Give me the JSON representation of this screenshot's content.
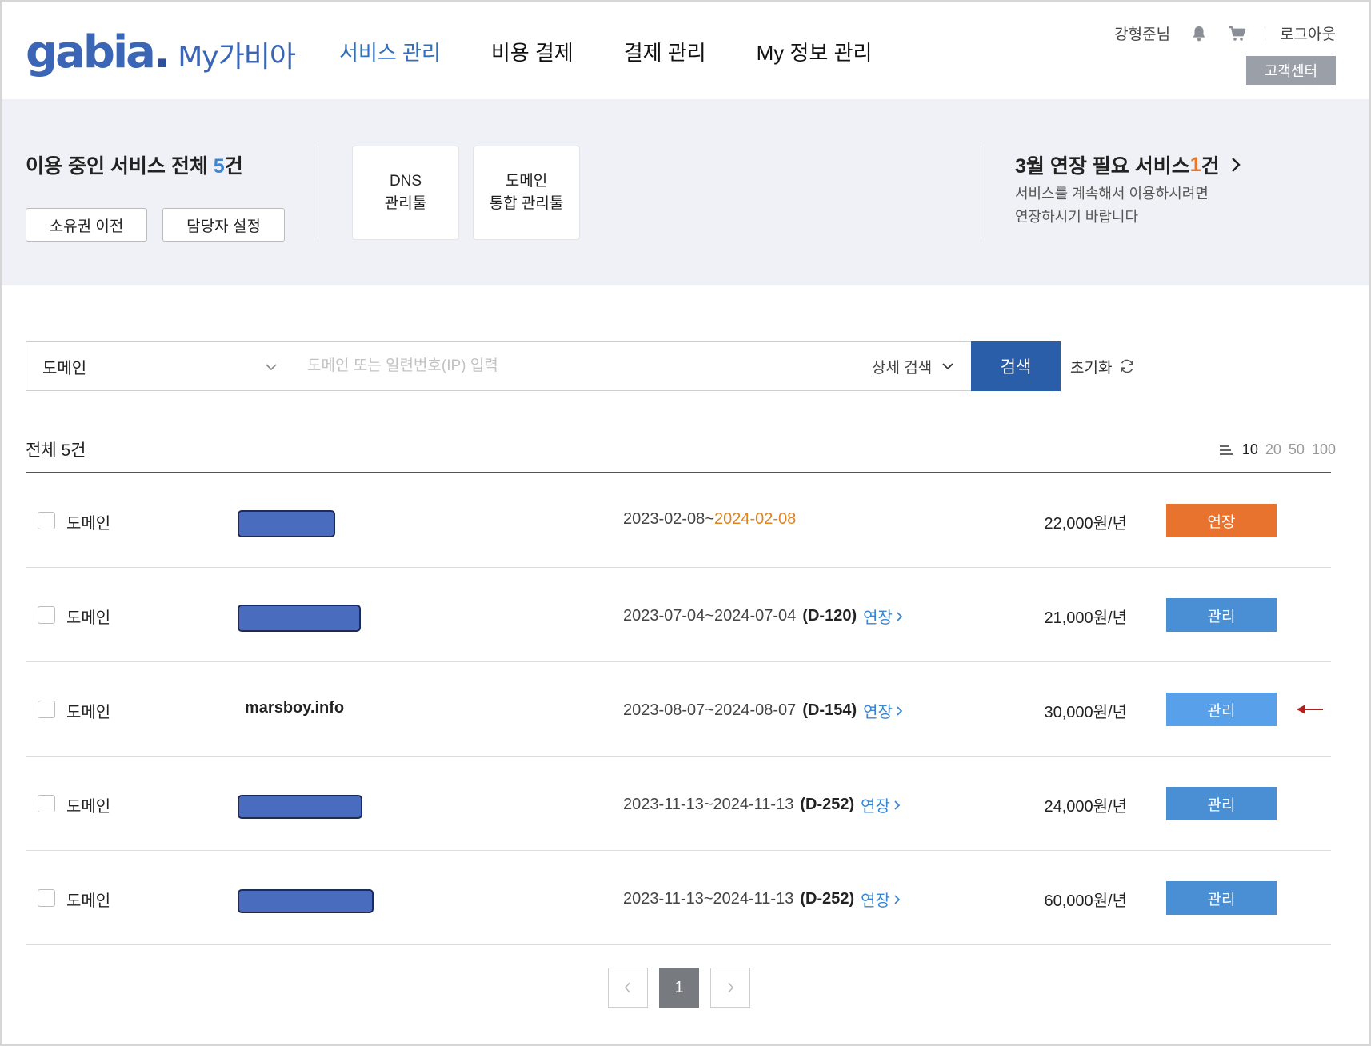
{
  "header": {
    "logo_text": "gabia",
    "logo_dot": ".",
    "logo_sub": "My가비아",
    "nav": [
      {
        "label": "서비스 관리",
        "active": true
      },
      {
        "label": "비용 결제",
        "active": false
      },
      {
        "label": "결제 관리",
        "active": false
      },
      {
        "label": "My 정보 관리",
        "active": false
      }
    ],
    "user_name": "강형준님",
    "logout_label": "로그아웃",
    "customer_center_label": "고객센터",
    "icons": [
      "bell-icon",
      "cart-icon"
    ]
  },
  "summary": {
    "title_prefix": "이용 중인 서비스 전체 ",
    "title_count": "5",
    "title_suffix": "건",
    "buttons": [
      "소유권 이전",
      "담당자 설정"
    ],
    "tools": [
      {
        "line1": "DNS",
        "line2": "관리툴"
      },
      {
        "line1": "도메인",
        "line2": "통합 관리툴"
      }
    ],
    "renewal": {
      "title_prefix": "3월 연장 필요 서비스 ",
      "count": "1",
      "title_suffix": "건",
      "desc_line1": "서비스를 계속해서 이용하시려면",
      "desc_line2": "연장하시기 바랍니다"
    }
  },
  "search": {
    "category_value": "도메인",
    "placeholder": "도메인 또는 일련번호(IP) 입력",
    "advanced_label": "상세 검색",
    "search_label": "검색",
    "reset_label": "초기화"
  },
  "list": {
    "total_label": "전체 5건",
    "page_sizes": [
      "10",
      "20",
      "50",
      "100"
    ],
    "selected_page_size": "10",
    "rows": [
      {
        "type": "도메인",
        "name": "",
        "masked": true,
        "start": "2023-02-08",
        "end": "2024-02-08",
        "expired": true,
        "dday": "",
        "renew_label": "",
        "price": "22,000원/년",
        "action": "연장",
        "action_style": "orange",
        "highlight": false
      },
      {
        "type": "도메인",
        "name": "",
        "masked": true,
        "start": "2023-07-04",
        "end": "2024-07-04",
        "expired": false,
        "dday": "(D-120)",
        "renew_label": "연장",
        "price": "21,000원/년",
        "action": "관리",
        "action_style": "blue",
        "highlight": false
      },
      {
        "type": "도메인",
        "name": "marsboy.info",
        "masked": false,
        "start": "2023-08-07",
        "end": "2024-08-07",
        "expired": false,
        "dday": "(D-154)",
        "renew_label": "연장",
        "price": "30,000원/년",
        "action": "관리",
        "action_style": "blue-hl",
        "highlight": true
      },
      {
        "type": "도메인",
        "name": "",
        "masked": true,
        "start": "2023-11-13",
        "end": "2024-11-13",
        "expired": false,
        "dday": "(D-252)",
        "renew_label": "연장",
        "price": "24,000원/년",
        "action": "관리",
        "action_style": "blue",
        "highlight": false
      },
      {
        "type": "도메인",
        "name": "",
        "masked": true,
        "start": "2023-11-13",
        "end": "2024-11-13",
        "expired": false,
        "dday": "(D-252)",
        "renew_label": "연장",
        "price": "60,000원/년",
        "action": "관리",
        "action_style": "blue",
        "highlight": false
      }
    ],
    "date_separator": " ~ "
  },
  "pagination": {
    "pages": [
      "1"
    ],
    "current": "1"
  },
  "colors": {
    "brand": "#3a66b5",
    "accent_blue": "#2a5ea8",
    "count_blue": "#3a86d4",
    "warning_orange": "#e8732f",
    "arrow_red": "#b0201c"
  }
}
